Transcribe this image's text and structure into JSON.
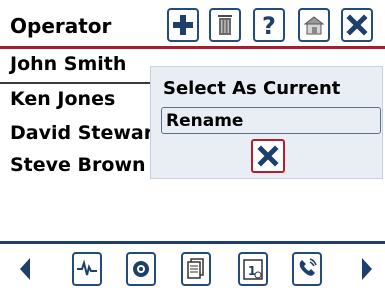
{
  "header": {
    "title": "Operator",
    "toolbar": [
      {
        "name": "add-icon"
      },
      {
        "name": "trash-icon"
      },
      {
        "name": "help-icon"
      },
      {
        "name": "home-icon"
      },
      {
        "name": "close-icon"
      }
    ]
  },
  "operators": [
    {
      "name": "John Smith"
    },
    {
      "name": "Ken Jones"
    },
    {
      "name": "David Stewart"
    },
    {
      "name": "Steve Brown"
    }
  ],
  "popup": {
    "title": "Select As Current",
    "rename_label": "Rename",
    "close_icon": "close-icon"
  },
  "footer": {
    "left_icon": "arrow-left-icon",
    "right_icon": "arrow-right-icon",
    "buttons": [
      {
        "name": "signal-icon"
      },
      {
        "name": "emblem-icon"
      },
      {
        "name": "documents-icon"
      },
      {
        "name": "calendar-icon"
      },
      {
        "name": "phone-icon"
      }
    ]
  },
  "colors": {
    "accent_red": "#a31f2e",
    "accent_blue": "#234c7a",
    "popup_bg": "#e9eef4"
  }
}
